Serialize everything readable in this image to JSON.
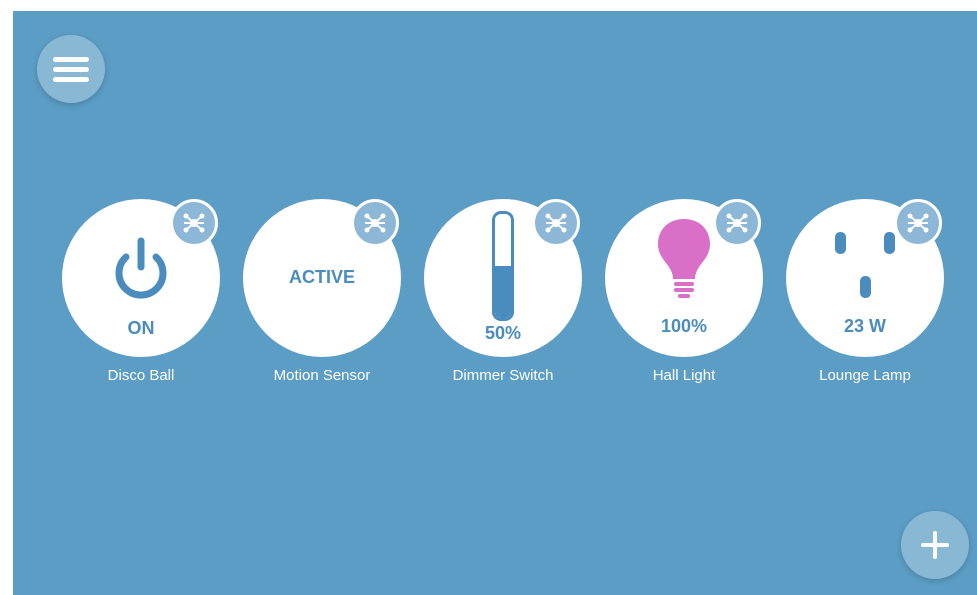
{
  "colors": {
    "background": "#5b9dc4",
    "accent": "#4a8cbd",
    "hub_badge": "#8db7d6",
    "bulb": "#d96fc7"
  },
  "toolbar": {
    "menu_icon": "hamburger-menu-icon",
    "add_icon": "plus-icon"
  },
  "devices": [
    {
      "name": "Disco Ball",
      "icon": "power-icon",
      "state": "ON"
    },
    {
      "name": "Motion Sensor",
      "state": "ACTIVE"
    },
    {
      "name": "Dimmer Switch",
      "icon": "slider-bar-icon",
      "value": "50%",
      "level": 0.5
    },
    {
      "name": "Hall Light",
      "icon": "lightbulb-icon",
      "value": "100%"
    },
    {
      "name": "Lounge Lamp",
      "icon": "power-outlet-icon",
      "value": "23 W"
    }
  ],
  "hub_icon": "hub-network-icon"
}
